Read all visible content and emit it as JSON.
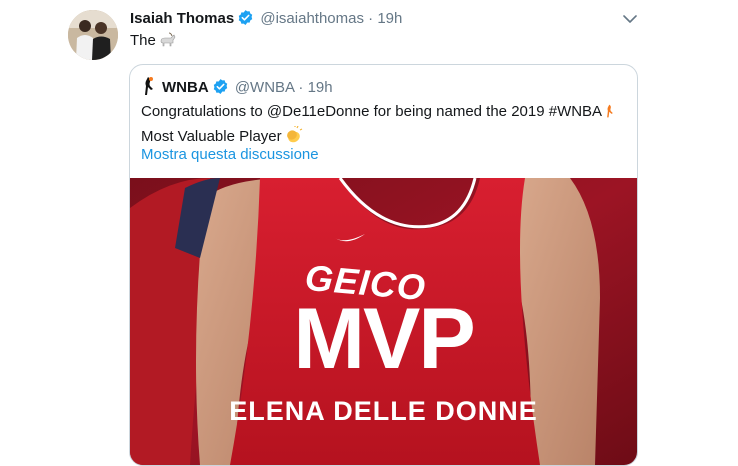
{
  "author": {
    "name": "Isaiah Thomas",
    "handle": "@isaiahthomas",
    "separator": "·",
    "time": "19h",
    "verified": true
  },
  "tweet": {
    "text": "The",
    "emoji_icon": "goat-icon"
  },
  "quoted": {
    "name": "WNBA",
    "handle": "@WNBA",
    "separator": "·",
    "time": "19h",
    "verified": true,
    "text": "Congratulations to @De11eDonne for being named the 2019 #WNBA",
    "text_line2": "Most Valuable Player",
    "show_thread": "Mostra questa discussione",
    "image": {
      "headline": "MVP",
      "player": "ELENA DELLE DONNE",
      "jersey_sponsor": "GEICO"
    }
  },
  "colors": {
    "link": "#1b95e0",
    "verified": "#1da1f2",
    "muted": "#657786",
    "border": "#ccd6dd",
    "jersey_red": "#c8102e"
  }
}
